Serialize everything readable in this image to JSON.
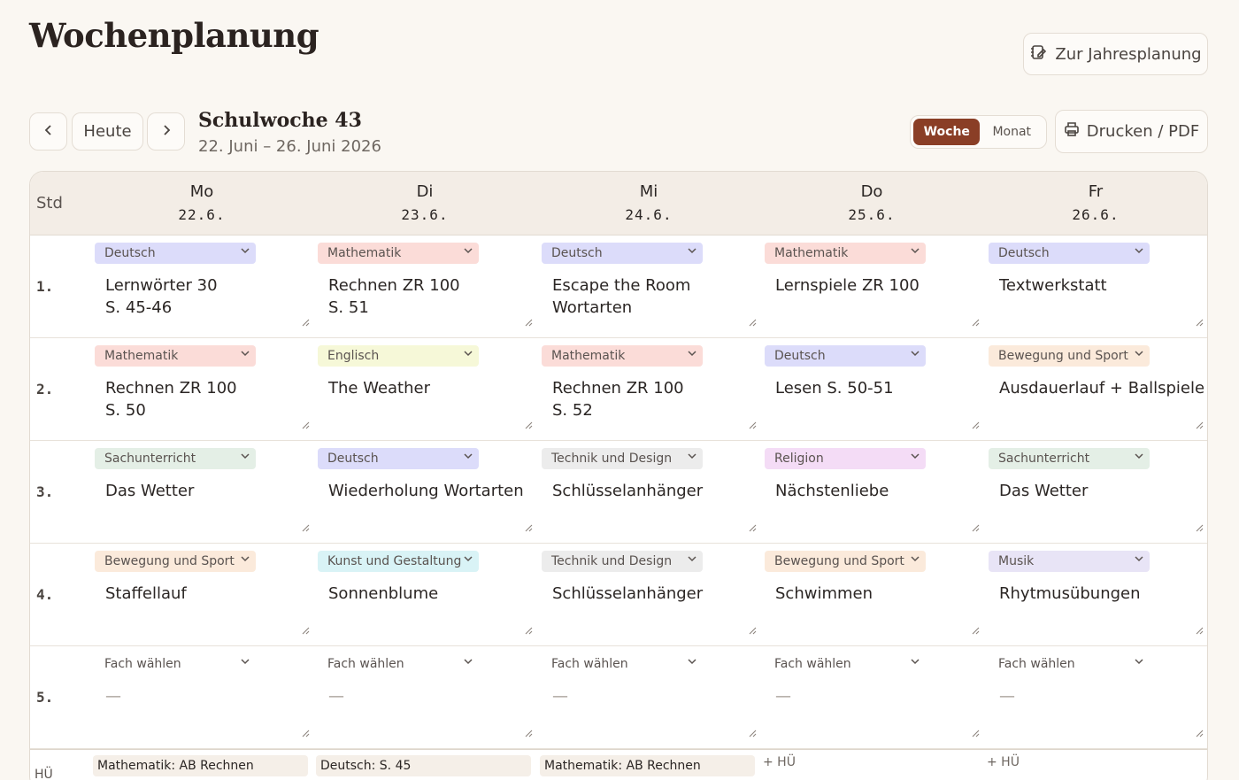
{
  "header": {
    "title": "Wochenplanung",
    "year_button": "Zur Jahresplanung",
    "today_button": "Heute",
    "week_title": "Schulwoche 43",
    "week_range": "22. Juni – 26. Juni 2026",
    "view_week": "Woche",
    "view_month": "Monat",
    "print_button": "Drucken / PDF"
  },
  "grid": {
    "std_label": "Std",
    "days": [
      {
        "name": "Mo",
        "date": "22.6."
      },
      {
        "name": "Di",
        "date": "23.6."
      },
      {
        "name": "Mi",
        "date": "24.6."
      },
      {
        "name": "Do",
        "date": "25.6."
      },
      {
        "name": "Fr",
        "date": "26.6."
      }
    ],
    "rows": [
      {
        "num": "1.",
        "cells": [
          {
            "subject": "Deutsch",
            "color": "#dcdcfa",
            "lesson": "Lernwörter 30\nS. 45-46"
          },
          {
            "subject": "Mathematik",
            "color": "#fbdcd8",
            "lesson": "Rechnen ZR 100\nS. 51"
          },
          {
            "subject": "Deutsch",
            "color": "#dcdcfa",
            "lesson": "Escape the Room\nWortarten"
          },
          {
            "subject": "Mathematik",
            "color": "#fbdcd8",
            "lesson": "Lernspiele ZR 100"
          },
          {
            "subject": "Deutsch",
            "color": "#dcdcfa",
            "lesson": "Textwerkstatt"
          }
        ]
      },
      {
        "num": "2.",
        "cells": [
          {
            "subject": "Mathematik",
            "color": "#fbdcd8",
            "lesson": "Rechnen ZR 100\nS. 50"
          },
          {
            "subject": "Englisch",
            "color": "#f6f8d8",
            "lesson": "The Weather"
          },
          {
            "subject": "Mathematik",
            "color": "#fbdcd8",
            "lesson": "Rechnen ZR 100\nS. 52"
          },
          {
            "subject": "Deutsch",
            "color": "#dcdcfa",
            "lesson": "Lesen S. 50-51"
          },
          {
            "subject": "Bewegung und Sport",
            "color": "#fbeadb",
            "lesson": "Ausdauerlauf + Ballspiele"
          }
        ]
      },
      {
        "num": "3.",
        "cells": [
          {
            "subject": "Sachunterricht",
            "color": "#e4efe6",
            "lesson": "Das Wetter"
          },
          {
            "subject": "Deutsch",
            "color": "#dcdcfa",
            "lesson": "Wiederholung Wortarten"
          },
          {
            "subject": "Technik und Design",
            "color": "#ececec",
            "lesson": "Schlüsselanhänger"
          },
          {
            "subject": "Religion",
            "color": "#f4dcf6",
            "lesson": "Nächstenliebe"
          },
          {
            "subject": "Sachunterricht",
            "color": "#e4efe6",
            "lesson": "Das Wetter"
          }
        ]
      },
      {
        "num": "4.",
        "cells": [
          {
            "subject": "Bewegung und Sport",
            "color": "#fbeadb",
            "lesson": "Staffellauf"
          },
          {
            "subject": "Kunst und Gestaltung",
            "color": "#d9f3f6",
            "lesson": "Sonnenblume"
          },
          {
            "subject": "Technik und Design",
            "color": "#ececec",
            "lesson": "Schlüsselanhänger"
          },
          {
            "subject": "Bewegung und Sport",
            "color": "#fbeadb",
            "lesson": "Schwimmen"
          },
          {
            "subject": "Musik",
            "color": "#e8e4f6",
            "lesson": "Rhytmusübungen"
          }
        ]
      },
      {
        "num": "5.",
        "cells": [
          {
            "subject": "Fach wählen",
            "color": "transparent",
            "lesson": "—",
            "empty": true
          },
          {
            "subject": "Fach wählen",
            "color": "transparent",
            "lesson": "—",
            "empty": true
          },
          {
            "subject": "Fach wählen",
            "color": "transparent",
            "lesson": "—",
            "empty": true
          },
          {
            "subject": "Fach wählen",
            "color": "transparent",
            "lesson": "—",
            "empty": true
          },
          {
            "subject": "Fach wählen",
            "color": "transparent",
            "lesson": "—",
            "empty": true
          }
        ]
      }
    ],
    "homework": {
      "label": "HÜ",
      "items": [
        {
          "text": "Mathematik: AB Rechnen"
        },
        {
          "text": "Deutsch: S. 45"
        },
        {
          "text": "Mathematik: AB Rechnen"
        },
        {
          "add": "+ HÜ"
        },
        {
          "add": "+ HÜ"
        }
      ]
    }
  }
}
